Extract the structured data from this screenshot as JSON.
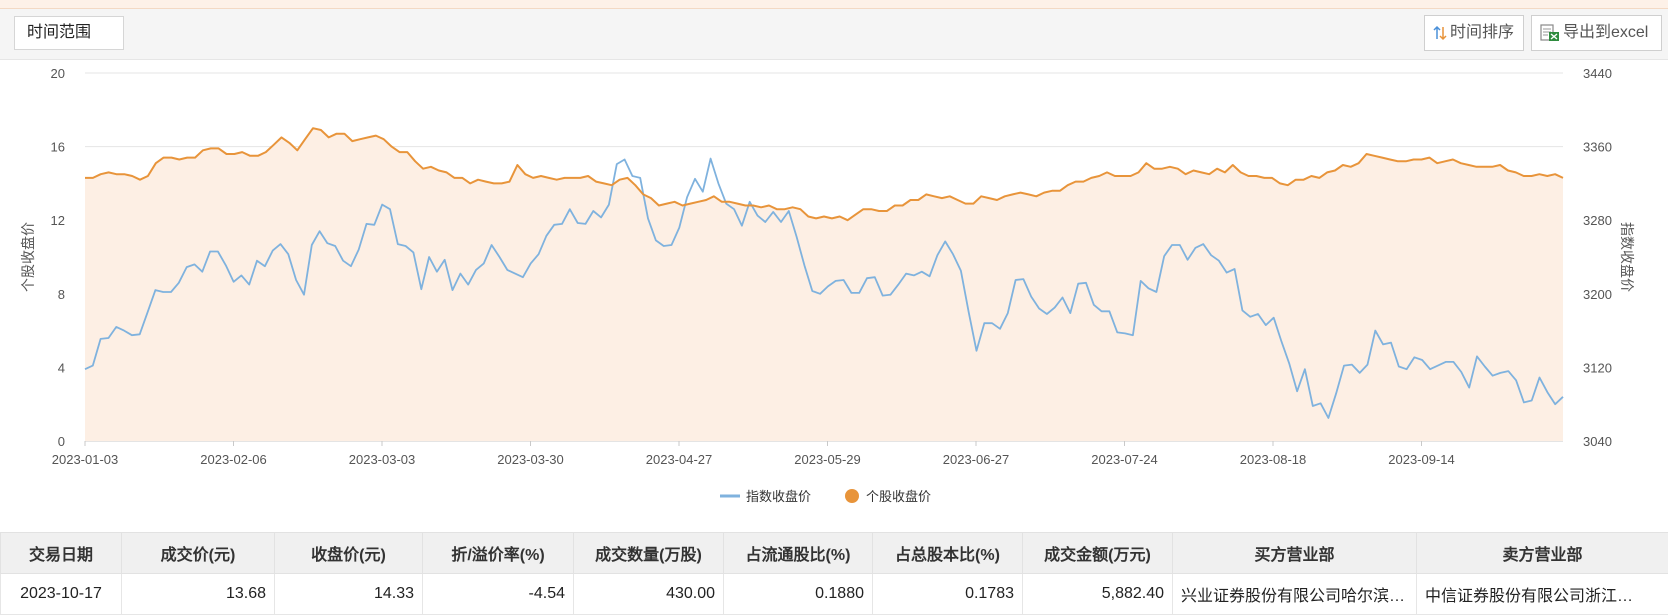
{
  "toolbar": {
    "time_range_label": "时间范围",
    "sort_label": "时间排序",
    "export_label": "导出到excel"
  },
  "chart_data": {
    "type": "line",
    "x_ticks": [
      "2023-01-03",
      "2023-02-06",
      "2023-03-03",
      "2023-03-30",
      "2023-04-27",
      "2023-05-29",
      "2023-06-27",
      "2023-07-24",
      "2023-08-18",
      "2023-09-14"
    ],
    "y_left": {
      "label": "个股收盘价",
      "min": 0,
      "max": 20,
      "ticks": [
        0,
        4,
        8,
        12,
        16,
        20
      ]
    },
    "y_right": {
      "label": "指数收盘价",
      "min": 3040,
      "max": 3440,
      "ticks": [
        3040,
        3120,
        3200,
        3280,
        3360,
        3440
      ]
    },
    "legend_position": "bottom-center",
    "grid": true,
    "series": [
      {
        "name": "指数收盘价",
        "axis": "right",
        "color": "#7fb2de",
        "area": false,
        "values": [
          3118,
          3122,
          3151,
          3152,
          3164,
          3160,
          3155,
          3156,
          3180,
          3204,
          3202,
          3202,
          3212,
          3229,
          3232,
          3224,
          3246,
          3246,
          3231,
          3213,
          3220,
          3210,
          3236,
          3230,
          3247,
          3254,
          3243,
          3215,
          3199,
          3253,
          3268,
          3255,
          3252,
          3236,
          3230,
          3248,
          3276,
          3275,
          3297,
          3292,
          3254,
          3252,
          3245,
          3205,
          3240,
          3224,
          3237,
          3204,
          3222,
          3210,
          3226,
          3233,
          3253,
          3240,
          3226,
          3222,
          3218,
          3233,
          3243,
          3263,
          3275,
          3276,
          3292,
          3277,
          3276,
          3290,
          3283,
          3297,
          3341,
          3346,
          3328,
          3326,
          3282,
          3258,
          3252,
          3253,
          3272,
          3305,
          3325,
          3311,
          3347,
          3320,
          3298,
          3292,
          3274,
          3300,
          3285,
          3278,
          3289,
          3278,
          3290,
          3262,
          3231,
          3203,
          3200,
          3208,
          3214,
          3215,
          3201,
          3201,
          3217,
          3218,
          3198,
          3199,
          3210,
          3222,
          3220,
          3224,
          3219,
          3242,
          3257,
          3243,
          3225,
          3180,
          3138,
          3168,
          3168,
          3162,
          3179,
          3215,
          3216,
          3197,
          3184,
          3178,
          3185,
          3196,
          3179,
          3211,
          3212,
          3188,
          3181,
          3181,
          3158,
          3157,
          3155,
          3214,
          3206,
          3202,
          3241,
          3253,
          3253,
          3237,
          3250,
          3254,
          3242,
          3236,
          3223,
          3227,
          3182,
          3175,
          3178,
          3166,
          3174,
          3148,
          3124,
          3094,
          3118,
          3078,
          3081,
          3065,
          3092,
          3122,
          3123,
          3114,
          3123,
          3160,
          3145,
          3147,
          3121,
          3118,
          3131,
          3128,
          3118,
          3122,
          3126,
          3126,
          3115,
          3098,
          3132,
          3121,
          3111,
          3114,
          3116,
          3106,
          3082,
          3084,
          3109,
          3093,
          3080,
          3088
        ]
      },
      {
        "name": "个股收盘价",
        "axis": "left",
        "color": "#e8943a",
        "area": true,
        "area_color": "#fdefe4",
        "values": [
          14.3,
          14.3,
          14.5,
          14.6,
          14.5,
          14.5,
          14.4,
          14.2,
          14.4,
          15.1,
          15.4,
          15.4,
          15.3,
          15.4,
          15.4,
          15.8,
          15.9,
          15.9,
          15.6,
          15.6,
          15.7,
          15.5,
          15.5,
          15.7,
          16.1,
          16.5,
          16.2,
          15.8,
          16.4,
          17.0,
          16.9,
          16.5,
          16.7,
          16.7,
          16.3,
          16.4,
          16.5,
          16.6,
          16.4,
          16.0,
          15.7,
          15.7,
          15.2,
          14.8,
          14.9,
          14.7,
          14.6,
          14.3,
          14.3,
          14.0,
          14.2,
          14.1,
          14.0,
          14.0,
          14.1,
          15.0,
          14.5,
          14.3,
          14.4,
          14.3,
          14.2,
          14.3,
          14.3,
          14.3,
          14.4,
          14.1,
          14.0,
          13.9,
          14.2,
          14.3,
          13.9,
          13.4,
          13.2,
          12.8,
          12.9,
          13.0,
          12.8,
          12.9,
          13.0,
          13.1,
          13.3,
          13.0,
          13.0,
          12.9,
          12.8,
          12.8,
          12.7,
          12.8,
          12.6,
          12.6,
          12.7,
          12.6,
          12.2,
          12.1,
          12.2,
          12.1,
          12.2,
          12.0,
          12.3,
          12.6,
          12.6,
          12.5,
          12.5,
          12.8,
          12.8,
          13.1,
          13.1,
          13.4,
          13.3,
          13.2,
          13.3,
          13.1,
          12.9,
          12.9,
          13.3,
          13.2,
          13.1,
          13.3,
          13.4,
          13.5,
          13.4,
          13.3,
          13.5,
          13.6,
          13.6,
          13.9,
          14.1,
          14.1,
          14.3,
          14.4,
          14.6,
          14.4,
          14.4,
          14.4,
          14.6,
          15.1,
          14.8,
          14.8,
          14.9,
          14.8,
          14.5,
          14.7,
          14.6,
          14.5,
          14.8,
          14.6,
          15.0,
          14.6,
          14.4,
          14.4,
          14.3,
          14.3,
          14.0,
          13.9,
          14.2,
          14.2,
          14.4,
          14.3,
          14.6,
          14.7,
          15.0,
          14.9,
          15.1,
          15.6,
          15.5,
          15.4,
          15.3,
          15.2,
          15.2,
          15.3,
          15.3,
          15.4,
          15.1,
          15.2,
          15.3,
          15.1,
          15.0,
          14.9,
          14.9,
          14.9,
          15.0,
          14.7,
          14.6,
          14.4,
          14.4,
          14.5,
          14.4,
          14.5,
          14.3
        ]
      }
    ]
  },
  "table": {
    "headers": [
      "交易日期",
      "成交价(元)",
      "收盘价(元)",
      "折/溢价率(%)",
      "成交数量(万股)",
      "占流通股比(%)",
      "占总股本比(%)",
      "成交金额(万元)",
      "买方营业部",
      "卖方营业部"
    ],
    "rows": [
      [
        "2023-10-17",
        "13.68",
        "14.33",
        "-4.54",
        "430.00",
        "0.1880",
        "0.1783",
        "5,882.40",
        "兴业证券股份有限公司哈尔滨…",
        "中信证券股份有限公司浙江…"
      ]
    ]
  }
}
